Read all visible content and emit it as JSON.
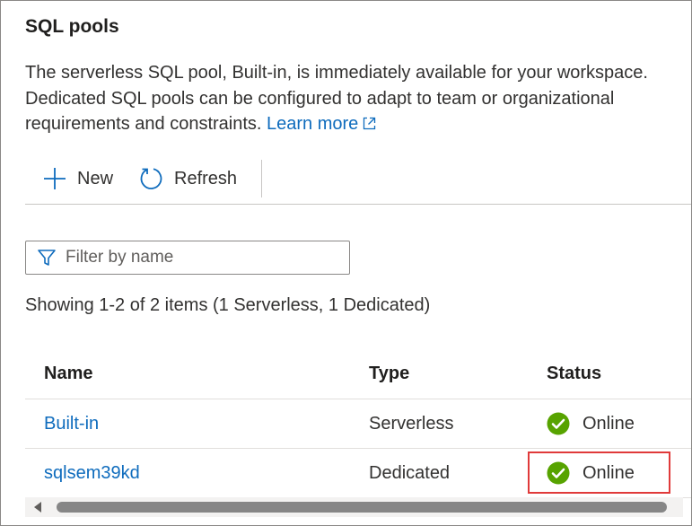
{
  "panel": {
    "title": "SQL pools",
    "description": "The serverless SQL pool, Built-in, is immediately available for your workspace. Dedicated SQL pools can be configured to adapt to team or organizational requirements and constraints. ",
    "learn_more_label": "Learn more"
  },
  "toolbar": {
    "new_label": "New",
    "refresh_label": "Refresh"
  },
  "filter": {
    "placeholder": "Filter by name",
    "value": ""
  },
  "summary_text": "Showing 1-2 of 2 items (1 Serverless, 1 Dedicated)",
  "table": {
    "columns": [
      "Name",
      "Type",
      "Status"
    ],
    "rows": [
      {
        "name": "Built-in",
        "type": "Serverless",
        "status": "Online"
      },
      {
        "name": "sqlsem39kd",
        "type": "Dedicated",
        "status": "Online"
      }
    ]
  },
  "colors": {
    "link": "#0f6cbd",
    "status_online": "#57a300",
    "highlight": "#e03a3a"
  },
  "icons": {
    "new": "plus-icon",
    "refresh": "refresh-icon",
    "filter": "filter-icon",
    "external": "external-link-icon",
    "status": "check-circle-icon"
  }
}
